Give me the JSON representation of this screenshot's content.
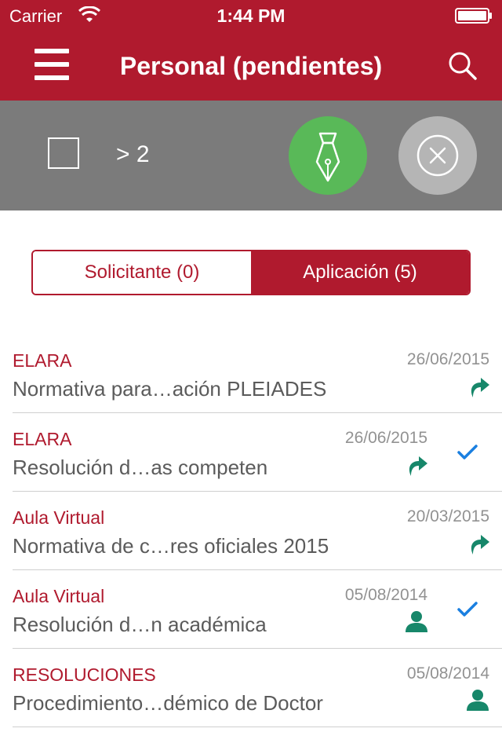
{
  "status_bar": {
    "carrier": "Carrier",
    "time": "1:44 PM"
  },
  "nav": {
    "title": "Personal (pendientes)"
  },
  "action_bar": {
    "selection_count": "> 2"
  },
  "segments": {
    "solicitante": "Solicitante (0)",
    "aplicacion": "Aplicación (5)",
    "selected": "aplicacion"
  },
  "colors": {
    "brand": "#b01a2e",
    "action_gray": "#7b7b7b",
    "sign_green": "#59b958",
    "icon_teal": "#17876a",
    "check_blue": "#1a7fe0"
  },
  "rows": [
    {
      "app": "ELARA",
      "date": "26/06/2015",
      "subject": "Normativa para…ación PLEIADES",
      "type_icon": "forward-arrow-icon",
      "checked": false
    },
    {
      "app": "ELARA",
      "date": "26/06/2015",
      "subject": "Resolución d…as competen",
      "type_icon": "forward-arrow-icon",
      "checked": true
    },
    {
      "app": "Aula Virtual",
      "date": "20/03/2015",
      "subject": "Normativa de c…res oficiales 2015",
      "type_icon": "forward-arrow-icon",
      "checked": false
    },
    {
      "app": "Aula Virtual",
      "date": "05/08/2014",
      "subject": "Resolución d…n académica",
      "type_icon": "person-icon",
      "checked": true
    },
    {
      "app": "RESOLUCIONES",
      "date": "05/08/2014",
      "subject": "Procedimiento…démico de Doctor",
      "type_icon": "person-icon",
      "checked": false
    }
  ]
}
